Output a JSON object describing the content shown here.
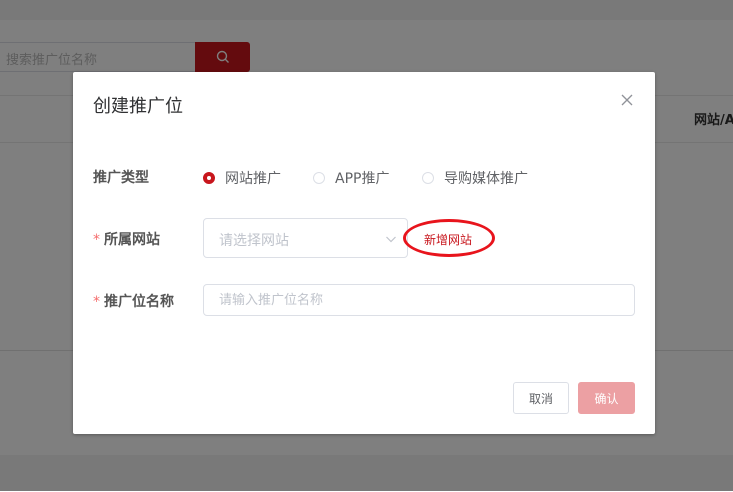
{
  "background": {
    "search": {
      "placeholder": "搜索推广位名称"
    },
    "table": {
      "column_header": "网站/A"
    }
  },
  "dialog": {
    "title": "创建推广位",
    "fields": {
      "type": {
        "label": "推广类型",
        "options": [
          "网站推广",
          "APP推广",
          "导购媒体推广"
        ],
        "selected": "网站推广"
      },
      "site": {
        "required_mark": "*",
        "label": "所属网站",
        "placeholder": "请选择网站",
        "add_link": "新增网站"
      },
      "name": {
        "required_mark": "*",
        "label": "推广位名称",
        "placeholder": "请输入推广位名称",
        "value": ""
      }
    },
    "buttons": {
      "cancel": "取消",
      "confirm": "确认"
    }
  },
  "colors": {
    "accent": "#c8161d",
    "confirm_disabled": "#eca0a3",
    "highlight_ring": "#e8141c",
    "required": "#f56c6c"
  },
  "icons": {
    "search_button": "search-icon",
    "close_button": "close-icon",
    "select_arrow": "chevron-down-icon"
  }
}
